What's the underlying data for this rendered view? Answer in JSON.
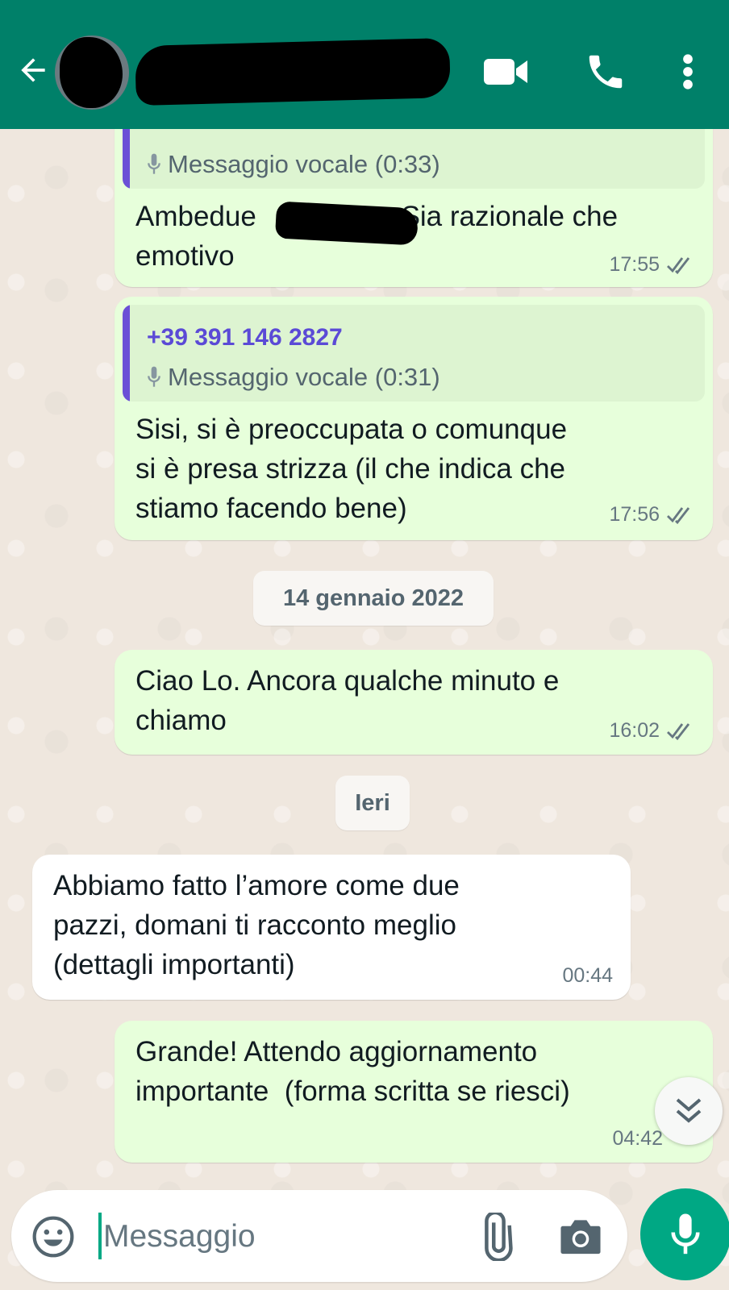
{
  "header": {
    "contact_name": "",
    "colors": {
      "bar": "#008069",
      "icons": "#ffffff"
    },
    "icons": [
      "back-arrow-icon",
      "video-call-icon",
      "voice-call-icon",
      "more-vert-icon"
    ]
  },
  "messages": [
    {
      "direction": "out",
      "quote": {
        "sender": "",
        "voice_label": "Messaggio vocale (0:33)"
      },
      "text_before": "Ambedue ",
      "text_after": "Sia razionale che",
      "text_line2": "emotivo",
      "time": "17:55"
    },
    {
      "direction": "out",
      "quote": {
        "sender": "+39 391 146 2827",
        "voice_label": "Messaggio vocale (0:31)"
      },
      "text": "Sisi, si è preoccupata o comunque\nsi è presa strizza (il che indica che\nstiamo facendo bene)",
      "time": "17:56"
    },
    {
      "direction": "out",
      "text": "Ciao Lo. Ancora qualche minuto e\nchiamo",
      "time": "16:02"
    },
    {
      "direction": "in",
      "text": "Abbiamo fatto l’amore come due\npazzi, domani ti racconto meglio\n(dettagli importanti)",
      "time": "00:44"
    },
    {
      "direction": "out",
      "text": "Grande! Attendo aggiornamento\nimportante  (forma scritta se riesci)",
      "time": "04:42"
    }
  ],
  "date_chips": [
    "14 gennaio 2022",
    "Ieri"
  ],
  "composer": {
    "placeholder": "Messaggio"
  },
  "colors": {
    "outgoing": "#e7ffdb",
    "incoming": "#ffffff",
    "accent": "#00a884",
    "quote_bar": "#6b50d6"
  }
}
